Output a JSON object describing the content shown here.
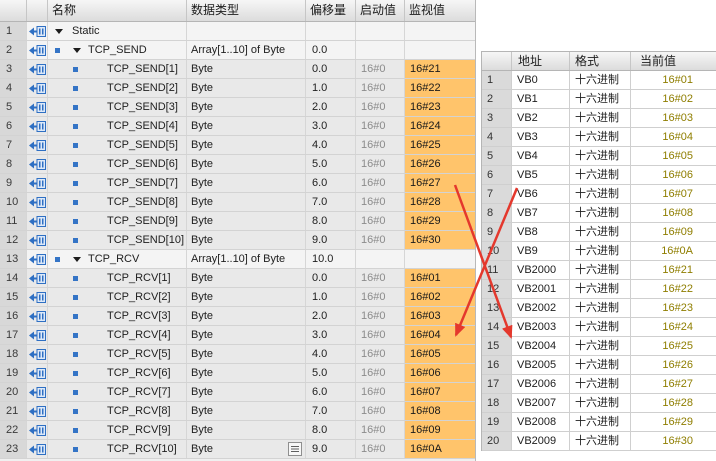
{
  "db_editor": {
    "columns": {
      "name": "名称",
      "data_type": "数据类型",
      "offset": "偏移量",
      "start_value": "启动值",
      "monitor_value": "监视值"
    },
    "sections": [
      {
        "num": "1",
        "name": "Static",
        "members": [
          {
            "num": "2",
            "name": "TCP_SEND",
            "data_type": "Array[1..10] of Byte",
            "offset": "0.0",
            "elements": [
              {
                "num": "3",
                "name": "TCP_SEND[1]",
                "data_type": "Byte",
                "offset": "0.0",
                "start_value": "16#0",
                "monitor_value": "16#21"
              },
              {
                "num": "4",
                "name": "TCP_SEND[2]",
                "data_type": "Byte",
                "offset": "1.0",
                "start_value": "16#0",
                "monitor_value": "16#22"
              },
              {
                "num": "5",
                "name": "TCP_SEND[3]",
                "data_type": "Byte",
                "offset": "2.0",
                "start_value": "16#0",
                "monitor_value": "16#23"
              },
              {
                "num": "6",
                "name": "TCP_SEND[4]",
                "data_type": "Byte",
                "offset": "3.0",
                "start_value": "16#0",
                "monitor_value": "16#24"
              },
              {
                "num": "7",
                "name": "TCP_SEND[5]",
                "data_type": "Byte",
                "offset": "4.0",
                "start_value": "16#0",
                "monitor_value": "16#25"
              },
              {
                "num": "8",
                "name": "TCP_SEND[6]",
                "data_type": "Byte",
                "offset": "5.0",
                "start_value": "16#0",
                "monitor_value": "16#26"
              },
              {
                "num": "9",
                "name": "TCP_SEND[7]",
                "data_type": "Byte",
                "offset": "6.0",
                "start_value": "16#0",
                "monitor_value": "16#27"
              },
              {
                "num": "10",
                "name": "TCP_SEND[8]",
                "data_type": "Byte",
                "offset": "7.0",
                "start_value": "16#0",
                "monitor_value": "16#28"
              },
              {
                "num": "11",
                "name": "TCP_SEND[9]",
                "data_type": "Byte",
                "offset": "8.0",
                "start_value": "16#0",
                "monitor_value": "16#29"
              },
              {
                "num": "12",
                "name": "TCP_SEND[10]",
                "data_type": "Byte",
                "offset": "9.0",
                "start_value": "16#0",
                "monitor_value": "16#30"
              }
            ]
          },
          {
            "num": "13",
            "name": "TCP_RCV",
            "data_type": "Array[1..10] of Byte",
            "offset": "10.0",
            "elements": [
              {
                "num": "14",
                "name": "TCP_RCV[1]",
                "data_type": "Byte",
                "offset": "0.0",
                "start_value": "16#0",
                "monitor_value": "16#01"
              },
              {
                "num": "15",
                "name": "TCP_RCV[2]",
                "data_type": "Byte",
                "offset": "1.0",
                "start_value": "16#0",
                "monitor_value": "16#02"
              },
              {
                "num": "16",
                "name": "TCP_RCV[3]",
                "data_type": "Byte",
                "offset": "2.0",
                "start_value": "16#0",
                "monitor_value": "16#03"
              },
              {
                "num": "17",
                "name": "TCP_RCV[4]",
                "data_type": "Byte",
                "offset": "3.0",
                "start_value": "16#0",
                "monitor_value": "16#04"
              },
              {
                "num": "18",
                "name": "TCP_RCV[5]",
                "data_type": "Byte",
                "offset": "4.0",
                "start_value": "16#0",
                "monitor_value": "16#05"
              },
              {
                "num": "19",
                "name": "TCP_RCV[6]",
                "data_type": "Byte",
                "offset": "5.0",
                "start_value": "16#0",
                "monitor_value": "16#06"
              },
              {
                "num": "20",
                "name": "TCP_RCV[7]",
                "data_type": "Byte",
                "offset": "6.0",
                "start_value": "16#0",
                "monitor_value": "16#07"
              },
              {
                "num": "21",
                "name": "TCP_RCV[8]",
                "data_type": "Byte",
                "offset": "7.0",
                "start_value": "16#0",
                "monitor_value": "16#08"
              },
              {
                "num": "22",
                "name": "TCP_RCV[9]",
                "data_type": "Byte",
                "offset": "8.0",
                "start_value": "16#0",
                "monitor_value": "16#09"
              },
              {
                "num": "23",
                "name": "TCP_RCV[10]",
                "data_type": "Byte",
                "offset": "9.0",
                "start_value": "16#0",
                "monitor_value": "16#0A",
                "show_type_browser": true
              }
            ]
          }
        ]
      }
    ]
  },
  "watch_table": {
    "columns": {
      "address": "地址",
      "format": "格式",
      "current_value": "当前值"
    },
    "rows": [
      {
        "num": "1",
        "address": "VB0",
        "format": "十六进制",
        "current_value": "16#01"
      },
      {
        "num": "2",
        "address": "VB1",
        "format": "十六进制",
        "current_value": "16#02"
      },
      {
        "num": "3",
        "address": "VB2",
        "format": "十六进制",
        "current_value": "16#03"
      },
      {
        "num": "4",
        "address": "VB3",
        "format": "十六进制",
        "current_value": "16#04"
      },
      {
        "num": "5",
        "address": "VB4",
        "format": "十六进制",
        "current_value": "16#05"
      },
      {
        "num": "6",
        "address": "VB5",
        "format": "十六进制",
        "current_value": "16#06"
      },
      {
        "num": "7",
        "address": "VB6",
        "format": "十六进制",
        "current_value": "16#07"
      },
      {
        "num": "8",
        "address": "VB7",
        "format": "十六进制",
        "current_value": "16#08"
      },
      {
        "num": "9",
        "address": "VB8",
        "format": "十六进制",
        "current_value": "16#09"
      },
      {
        "num": "10",
        "address": "VB9",
        "format": "十六进制",
        "current_value": "16#0A"
      },
      {
        "num": "11",
        "address": "VB2000",
        "format": "十六进制",
        "current_value": "16#21"
      },
      {
        "num": "12",
        "address": "VB2001",
        "format": "十六进制",
        "current_value": "16#22"
      },
      {
        "num": "13",
        "address": "VB2002",
        "format": "十六进制",
        "current_value": "16#23"
      },
      {
        "num": "14",
        "address": "VB2003",
        "format": "十六进制",
        "current_value": "16#24"
      },
      {
        "num": "15",
        "address": "VB2004",
        "format": "十六进制",
        "current_value": "16#25"
      },
      {
        "num": "16",
        "address": "VB2005",
        "format": "十六进制",
        "current_value": "16#26"
      },
      {
        "num": "17",
        "address": "VB2006",
        "format": "十六进制",
        "current_value": "16#27"
      },
      {
        "num": "18",
        "address": "VB2007",
        "format": "十六进制",
        "current_value": "16#28"
      },
      {
        "num": "19",
        "address": "VB2008",
        "format": "十六进制",
        "current_value": "16#29"
      },
      {
        "num": "20",
        "address": "VB2009",
        "format": "十六进制",
        "current_value": "16#30"
      }
    ]
  },
  "icons": {
    "row_type": "db-interface-icon",
    "expand": "expanded-triangle-icon",
    "member": "member-square-icon",
    "type_browser": "list-browse-icon",
    "annotation": "red-arrow-icon"
  },
  "colors": {
    "monitor_value_background": "#ffc46b",
    "current_value_text": "#8f7e00",
    "start_value_text": "#8c8c8c",
    "annotation_arrows": "#e4382d"
  }
}
